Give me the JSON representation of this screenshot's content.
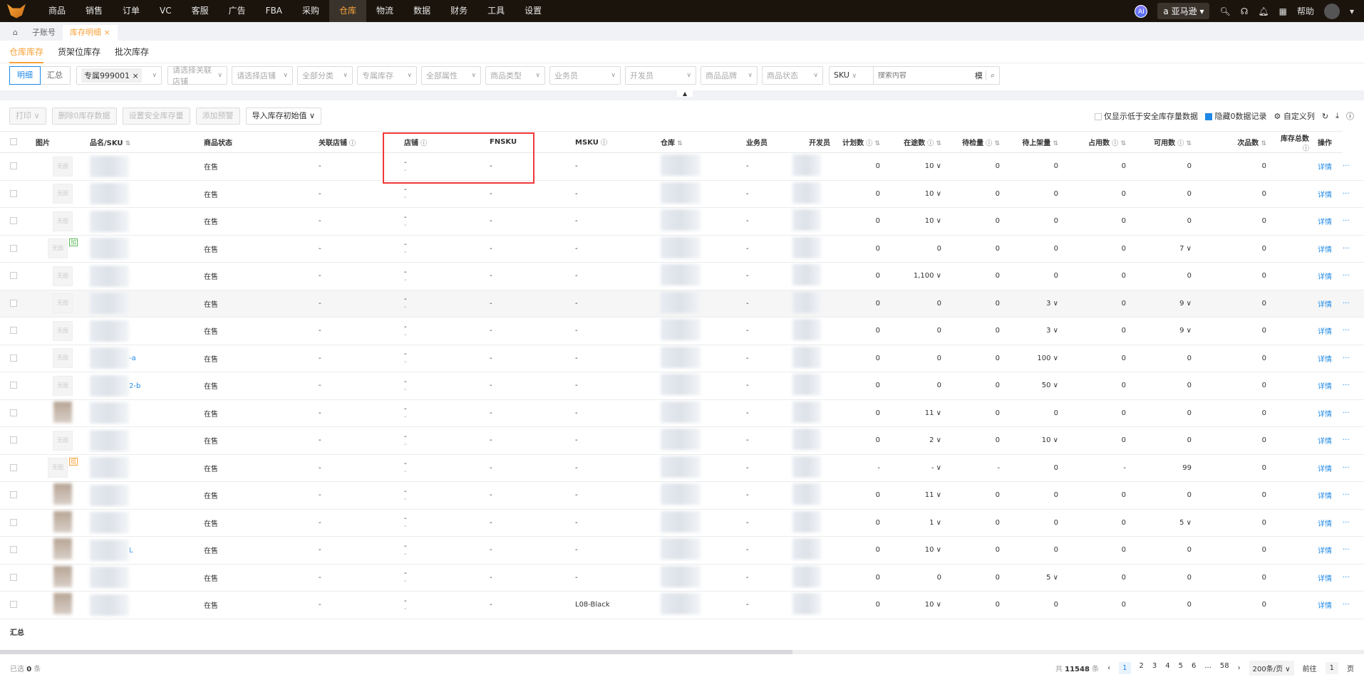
{
  "nav": {
    "items": [
      "商品",
      "销售",
      "订单",
      "VC",
      "客服",
      "广告",
      "FBA",
      "采购",
      "仓库",
      "物流",
      "数据",
      "财务",
      "工具",
      "设置"
    ],
    "active": 8,
    "ai": "AI",
    "platform": "亚马逊",
    "help": "帮助"
  },
  "tabs": {
    "home_icon": "home-icon",
    "items": [
      "子账号",
      "库存明细"
    ],
    "active": 1
  },
  "subtabs": {
    "items": [
      "仓库库存",
      "货架位库存",
      "批次库存"
    ],
    "active": 0
  },
  "filters": {
    "mode": [
      "明细",
      "汇总"
    ],
    "mode_active": 0,
    "account_chip": "专属999001",
    "selects": [
      "请选择关联店铺",
      "请选择店铺",
      "全部分类",
      "专属库存",
      "全部属性",
      "商品类型",
      "业务员",
      "开发员",
      "商品品牌",
      "商品状态"
    ],
    "search_field": "SKU",
    "search_placeholder": "搜索内容",
    "search_mode": "模"
  },
  "toolbar": {
    "buttons": [
      "打印",
      "删除0库存数据",
      "设置安全库存量",
      "添加预警",
      "导入库存初始值"
    ],
    "only_below_safety": "仅显示低于安全库存量数据",
    "hide_zero": "隐藏0数据记录",
    "hide_zero_checked": true,
    "custom_columns": "自定义列"
  },
  "columns": [
    "图片",
    "品名/SKU",
    "商品状态",
    "关联店铺",
    "店铺",
    "FNSKU",
    "MSKU",
    "仓库",
    "业务员",
    "开发员",
    "计划数",
    "在途数",
    "待检量",
    "待上架量",
    "占用数",
    "可用数",
    "次品数",
    "库存总数",
    "操作"
  ],
  "rows": [
    {
      "img": "无图",
      "sku": "",
      "status": "在售",
      "planned": "0",
      "transit": "10",
      "inspect": "0",
      "shelve": "0",
      "occupied": "0",
      "available": "0",
      "defect": "0",
      "msku": "-"
    },
    {
      "img": "无图",
      "sku": "",
      "status": "在售",
      "planned": "0",
      "transit": "10",
      "inspect": "0",
      "shelve": "0",
      "occupied": "0",
      "available": "0",
      "defect": "0",
      "msku": "-"
    },
    {
      "img": "无图",
      "sku": "",
      "status": "在售",
      "planned": "0",
      "transit": "10",
      "inspect": "0",
      "shelve": "0",
      "occupied": "0",
      "available": "0",
      "defect": "0",
      "msku": "-"
    },
    {
      "img": "无图",
      "badge": "加",
      "sku": "",
      "status": "在售",
      "planned": "0",
      "transit": "0",
      "inspect": "0",
      "shelve": "0",
      "occupied": "0",
      "available": "7",
      "defect": "0",
      "msku": "-"
    },
    {
      "img": "无图",
      "sku": "",
      "status": "在售",
      "planned": "0",
      "transit": "1,100",
      "inspect": "0",
      "shelve": "0",
      "occupied": "0",
      "available": "0",
      "defect": "0",
      "msku": "-"
    },
    {
      "img": "无图",
      "sku": "",
      "status": "在售",
      "planned": "0",
      "transit": "0",
      "inspect": "0",
      "shelve": "3",
      "occupied": "0",
      "available": "9",
      "defect": "0",
      "msku": "-"
    },
    {
      "img": "无图",
      "sku": "",
      "status": "在售",
      "planned": "0",
      "transit": "0",
      "inspect": "0",
      "shelve": "3",
      "occupied": "0",
      "available": "9",
      "defect": "0",
      "msku": "-"
    },
    {
      "img": "无图",
      "sku": "-a",
      "status": "在售",
      "planned": "0",
      "transit": "0",
      "inspect": "0",
      "shelve": "100",
      "occupied": "0",
      "available": "0",
      "defect": "0",
      "msku": "-"
    },
    {
      "img": "无图",
      "sku": "2-b",
      "status": "在售",
      "planned": "0",
      "transit": "0",
      "inspect": "0",
      "shelve": "50",
      "occupied": "0",
      "available": "0",
      "defect": "0",
      "msku": "-"
    },
    {
      "img": "",
      "sku": "",
      "status": "在售",
      "planned": "0",
      "transit": "11",
      "inspect": "0",
      "shelve": "0",
      "occupied": "0",
      "available": "0",
      "defect": "0",
      "msku": "-"
    },
    {
      "img": "无图",
      "sku": "",
      "status": "在售",
      "planned": "0",
      "transit": "2",
      "inspect": "0",
      "shelve": "10",
      "occupied": "0",
      "available": "0",
      "defect": "0",
      "msku": "-"
    },
    {
      "img": "无图",
      "badge": "组",
      "sku": "",
      "status": "在售",
      "planned": "-",
      "transit": "-",
      "inspect": "-",
      "shelve": "0",
      "occupied": "-",
      "available": "99",
      "defect": "0",
      "msku": "-"
    },
    {
      "img": "",
      "sku": "",
      "status": "在售",
      "planned": "0",
      "transit": "11",
      "inspect": "0",
      "shelve": "0",
      "occupied": "0",
      "available": "0",
      "defect": "0",
      "msku": "-"
    },
    {
      "img": "",
      "sku": "",
      "status": "在售",
      "planned": "0",
      "transit": "1",
      "inspect": "0",
      "shelve": "0",
      "occupied": "0",
      "available": "5",
      "defect": "0",
      "msku": "-"
    },
    {
      "img": "",
      "sku": "L",
      "status": "在售",
      "planned": "0",
      "transit": "10",
      "inspect": "0",
      "shelve": "0",
      "occupied": "0",
      "available": "0",
      "defect": "0",
      "msku": "-"
    },
    {
      "img": "",
      "sku": "",
      "status": "在售",
      "planned": "0",
      "transit": "0",
      "inspect": "0",
      "shelve": "5",
      "occupied": "0",
      "available": "0",
      "defect": "0",
      "msku": "-"
    },
    {
      "img": "",
      "sku": "",
      "status": "在售",
      "planned": "0",
      "transit": "10",
      "inspect": "0",
      "shelve": "0",
      "occupied": "0",
      "available": "0",
      "defect": "0",
      "msku": "L08-Black"
    }
  ],
  "dropdown_cells": {
    "transit": [
      "10",
      "10",
      "10",
      "1,100",
      "11",
      "2",
      "-",
      "11",
      "1",
      "10",
      "10"
    ],
    "shelve": [
      "3",
      "3",
      "100",
      "50",
      "10",
      "5"
    ],
    "available": [
      "7",
      "9",
      "9",
      "5"
    ]
  },
  "row_action": "详情",
  "row_more": "···",
  "dash": "-",
  "summary_label": "汇总",
  "footer": {
    "selected_prefix": "已选",
    "selected_count": "0",
    "selected_suffix": "条",
    "total_prefix": "共",
    "total": "11548",
    "total_suffix": "条",
    "pages": [
      "1",
      "2",
      "3",
      "4",
      "5",
      "6",
      "...",
      "58"
    ],
    "current_page": "1",
    "page_size": "200条/页",
    "goto": "前往",
    "goto_value": "1",
    "page_suffix": "页"
  },
  "colors": {
    "accent": "#f7a23b",
    "link": "#1e88e5",
    "highlight_box": "#f03838"
  }
}
